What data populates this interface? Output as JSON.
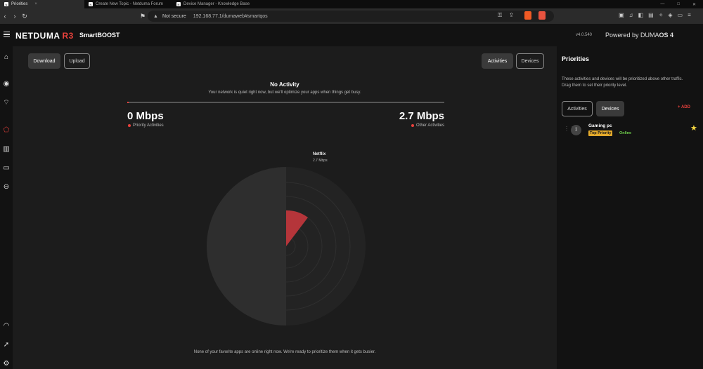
{
  "browser": {
    "tabs": [
      {
        "label": "Priorities",
        "active": true
      },
      {
        "label": "Create New Topic - Netduma Forum",
        "active": false
      },
      {
        "label": "Device Manager - Knowledge Base",
        "active": false
      }
    ],
    "security_label": "Not secure",
    "url": "192.168.77.1/dumaweb#smartqos"
  },
  "appbar": {
    "logo_main": "NETDUMA",
    "logo_model": "R3",
    "app_title": "SmartBOOST",
    "version": "v4.0.540",
    "powered_prefix": "Powered by DUMA",
    "powered_os": "OS 4"
  },
  "main": {
    "download_label": "Download",
    "upload_label": "Upload",
    "activities_label": "Activities",
    "devices_label": "Devices",
    "status_title": "No Activity",
    "status_sub": "Your network is quiet right now, but we'll optimize your apps when things get busy.",
    "priority_speed": "0 Mbps",
    "priority_label": "Priority Activities",
    "other_speed": "2.7 Mbps",
    "other_label": "Other Activities",
    "chart_app": "Netflix",
    "chart_app_speed": "2.7 Mbps",
    "footer": "None of your favorite apps are online right now. We're ready to prioritize them when it gets busier."
  },
  "sidebar": {
    "title": "Priorities",
    "description": "These activities and devices will be prioritized above other traffic. Drag them to set their priority level.",
    "activities_tab": "Activities",
    "devices_tab": "Devices",
    "add_label": "+ ADD",
    "devices": [
      {
        "rank": "1",
        "name": "Gaming pc",
        "badge": "Top Priority",
        "status": "Online"
      }
    ]
  },
  "colors": {
    "accent": "#e8413c",
    "badge": "#e3a92b",
    "online": "#6fcf4a"
  },
  "icons": [
    "home-icon",
    "location-icon",
    "wifi-icon",
    "smartboost-icon",
    "chart-icon",
    "devices-icon",
    "block-icon",
    "speedometer-icon",
    "rocket-icon",
    "settings-icon"
  ]
}
